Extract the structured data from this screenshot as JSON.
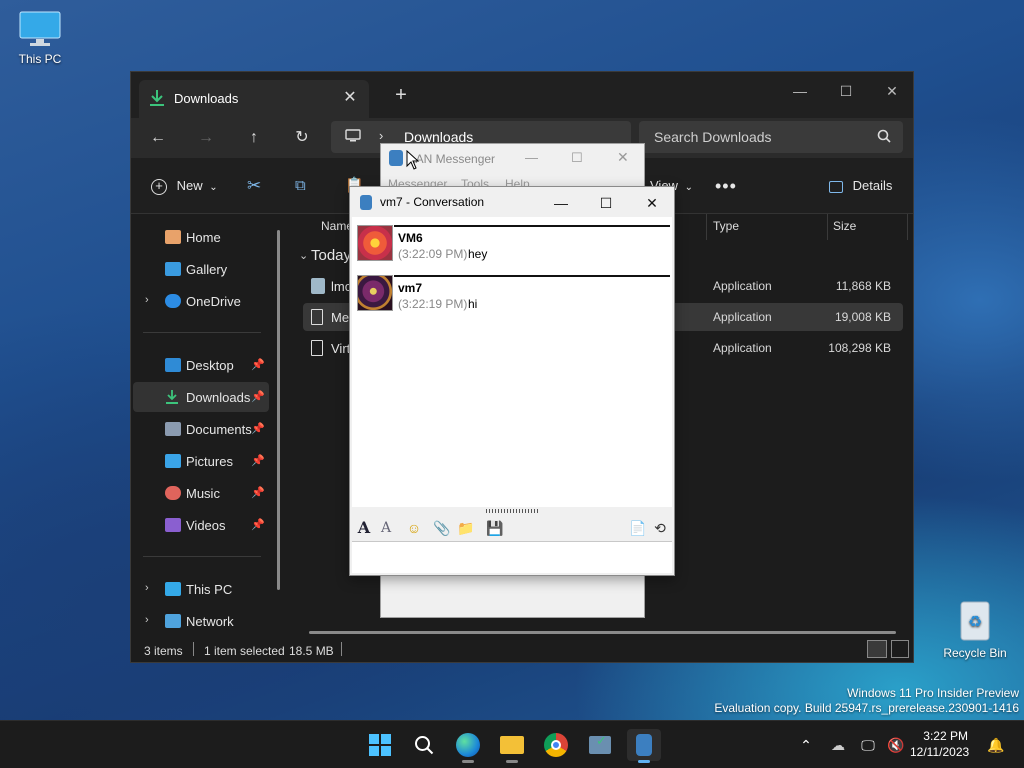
{
  "desktop": {
    "this_pc_label": "This PC",
    "recycle_bin_label": "Recycle Bin",
    "watermark_line1": "Windows 11 Pro Insider Preview",
    "watermark_line2": "Evaluation copy. Build 25947.rs_prerelease.230901-1416"
  },
  "explorer": {
    "tab_label": "Downloads",
    "breadcrumb": "Downloads",
    "search_placeholder": "Search Downloads",
    "toolbar": {
      "new_label": "New",
      "view_label": "View",
      "details_label": "Details"
    },
    "sidebar": {
      "home": "Home",
      "gallery": "Gallery",
      "onedrive": "OneDrive",
      "desktop": "Desktop",
      "downloads": "Downloads",
      "documents": "Documents",
      "pictures": "Pictures",
      "music": "Music",
      "videos": "Videos",
      "this_pc": "This PC",
      "network": "Network"
    },
    "columns": {
      "name": "Name",
      "type": "Type",
      "size": "Size"
    },
    "group_label": "Today",
    "files": [
      {
        "name": "lmc",
        "type": "Application",
        "size": "11,868 KB"
      },
      {
        "name": "Med",
        "type": "Application",
        "size": "19,008 KB"
      },
      {
        "name": "Virtu",
        "type": "Application",
        "size": "108,298 KB"
      }
    ],
    "status": {
      "items": "3 items",
      "selected": "1 item selected",
      "size": "18.5 MB"
    }
  },
  "lan_messenger": {
    "title": "LAN Messenger",
    "menu": [
      "Messenger",
      "Tools",
      "Help"
    ]
  },
  "conversation": {
    "title": "vm7 - Conversation",
    "messages": [
      {
        "sender": "VM6",
        "time": "(3:22:09 PM)",
        "text": "hey"
      },
      {
        "sender": "vm7",
        "time": "(3:22:19 PM)",
        "text": "hi"
      }
    ]
  },
  "taskbar": {
    "time": "3:22 PM",
    "date": "12/11/2023"
  },
  "colors": {
    "accent": "#5fb2f2",
    "download_green": "#3cc47c"
  }
}
